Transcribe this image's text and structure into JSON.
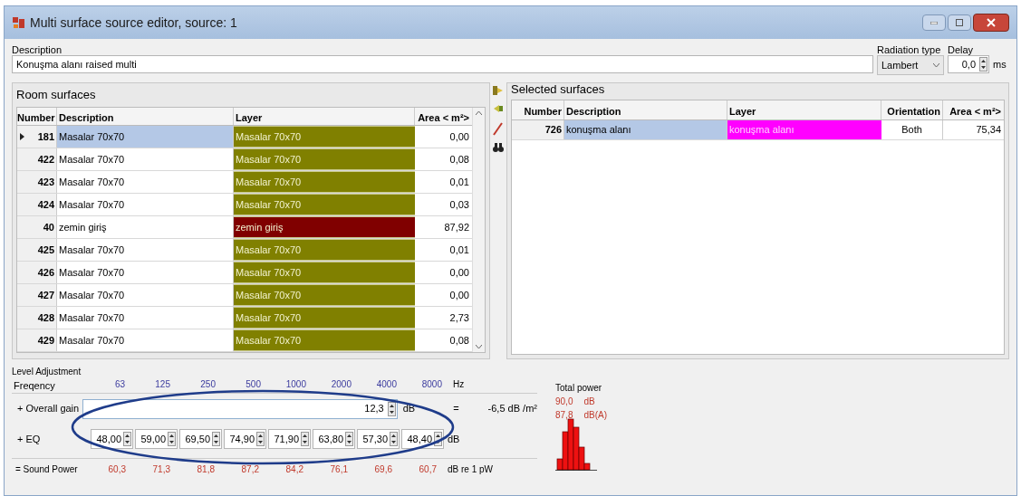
{
  "window": {
    "title": "Multi surface source editor, source: 1"
  },
  "description": {
    "label": "Description",
    "value": "Konuşma alanı raised multi"
  },
  "radiation_type": {
    "label": "Radiation type",
    "value": "Lambert"
  },
  "delay": {
    "label": "Delay",
    "value": "0,0",
    "unit": "ms"
  },
  "room_surfaces": {
    "title": "Room surfaces",
    "columns": [
      "Number",
      "Description",
      "Layer",
      "Area < m²>"
    ],
    "rows": [
      {
        "number": "181",
        "description": "Masalar 70x70",
        "layer": "Masalar 70x70",
        "color": "#808000",
        "area": "0,00",
        "selected": true
      },
      {
        "number": "422",
        "description": "Masalar 70x70",
        "layer": "Masalar 70x70",
        "color": "#808000",
        "area": "0,08",
        "selected": false
      },
      {
        "number": "423",
        "description": "Masalar 70x70",
        "layer": "Masalar 70x70",
        "color": "#808000",
        "area": "0,01",
        "selected": false
      },
      {
        "number": "424",
        "description": "Masalar 70x70",
        "layer": "Masalar 70x70",
        "color": "#808000",
        "area": "0,03",
        "selected": false
      },
      {
        "number": "40",
        "description": "zemin giriş",
        "layer": "zemin giriş",
        "color": "#800000",
        "area": "87,92",
        "selected": false
      },
      {
        "number": "425",
        "description": "Masalar 70x70",
        "layer": "Masalar 70x70",
        "color": "#808000",
        "area": "0,01",
        "selected": false
      },
      {
        "number": "426",
        "description": "Masalar 70x70",
        "layer": "Masalar 70x70",
        "color": "#808000",
        "area": "0,00",
        "selected": false
      },
      {
        "number": "427",
        "description": "Masalar 70x70",
        "layer": "Masalar 70x70",
        "color": "#808000",
        "area": "0,00",
        "selected": false
      },
      {
        "number": "428",
        "description": "Masalar 70x70",
        "layer": "Masalar 70x70",
        "color": "#808000",
        "area": "2,73",
        "selected": false
      },
      {
        "number": "429",
        "description": "Masalar 70x70",
        "layer": "Masalar 70x70",
        "color": "#808000",
        "area": "0,08",
        "selected": false
      }
    ]
  },
  "selected_surfaces": {
    "title": "Selected surfaces",
    "columns": [
      "Number",
      "Description",
      "Layer",
      "Orientation",
      "Area < m²>"
    ],
    "rows": [
      {
        "number": "726",
        "description": "konuşma alanı",
        "layer": "konuşma alanı",
        "color": "#ff00ff",
        "orientation": "Both",
        "area": "75,34",
        "selected": true
      }
    ]
  },
  "level_adjustment": {
    "title": "Level Adjustment",
    "frequency_label": "Freqency",
    "frequencies": [
      "63",
      "125",
      "250",
      "500",
      "1000",
      "2000",
      "4000",
      "8000"
    ],
    "frequency_unit": "Hz",
    "overall_gain": {
      "label": "+ Overall gain",
      "value": "12,3",
      "unit": "dB",
      "equals": "=",
      "result": "-6,5 dB /m²"
    },
    "eq": {
      "label": "+ EQ",
      "values": [
        "48,00",
        "59,00",
        "69,50",
        "74,90",
        "71,90",
        "63,80",
        "57,30",
        "48,40"
      ],
      "unit": "dB"
    },
    "sound_power": {
      "label": "= Sound Power",
      "values": [
        "60,3",
        "71,3",
        "81,8",
        "87,2",
        "84,2",
        "76,1",
        "69,6",
        "60,7"
      ],
      "unit": "dB re 1 pW"
    },
    "total_power": {
      "title": "Total power",
      "rows": [
        {
          "value": "90,0",
          "unit": "dB"
        },
        {
          "value": "87,8",
          "unit": "dB(A)"
        }
      ]
    }
  }
}
